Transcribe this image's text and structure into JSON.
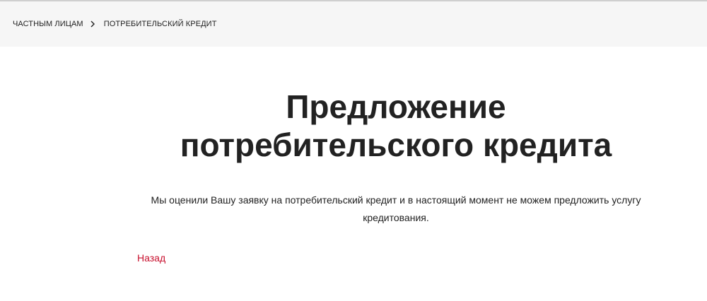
{
  "breadcrumb": {
    "items": [
      {
        "label": "ЧАСТНЫМ ЛИЦАМ"
      },
      {
        "label": "ПОТРЕБИТЕЛЬСКИЙ КРЕДИТ"
      }
    ],
    "separator_icon": "chevron-right-icon"
  },
  "main": {
    "title_line1": "Предложение",
    "title_line2": "потребительского кредита",
    "message": "Мы оценили Вашу заявку на потребительский кредит и в настоящий момент не можем предложить услугу кредитования.",
    "back_label": "Назад"
  },
  "colors": {
    "accent": "#c8102e",
    "breadcrumb_bg": "#f6f6f6",
    "text": "#222222"
  }
}
